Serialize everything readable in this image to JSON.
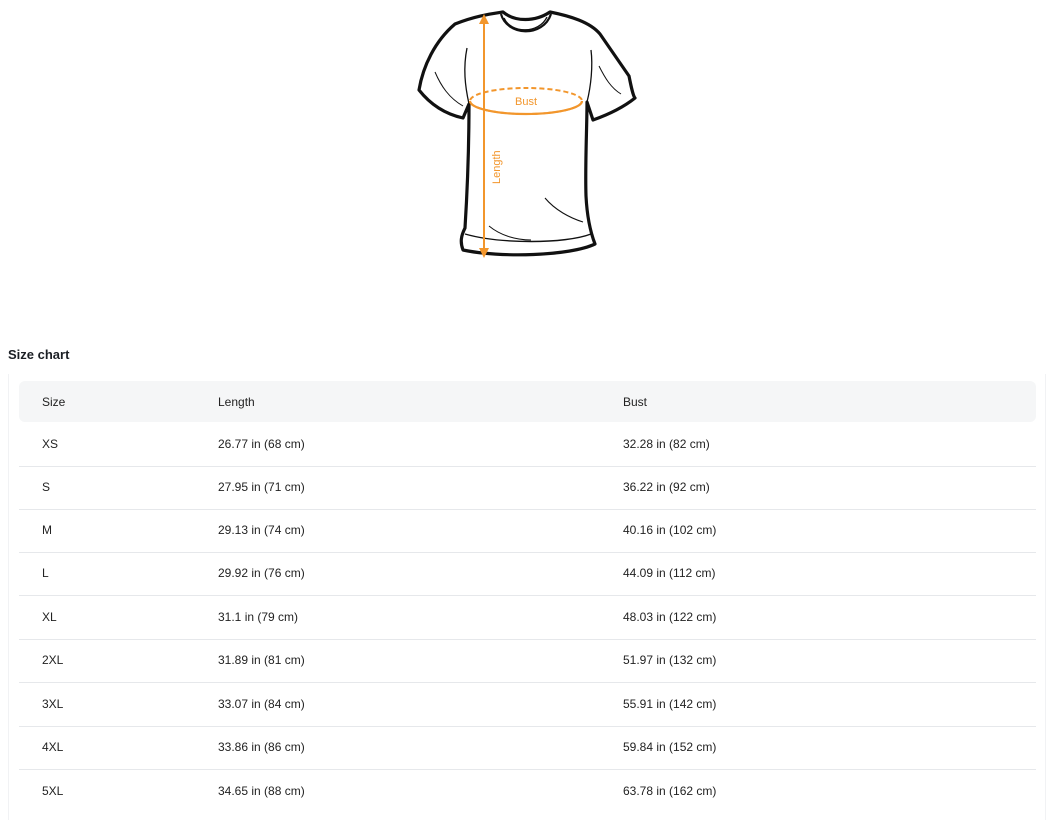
{
  "diagram": {
    "bust_label": "Bust",
    "length_label": "Length",
    "accent_color": "#f2962c"
  },
  "size_chart": {
    "title": "Size chart",
    "columns": [
      "Size",
      "Length",
      "Bust"
    ],
    "rows": [
      {
        "size": "XS",
        "length": "26.77 in  (68 cm)",
        "bust": "32.28 in  (82 cm)"
      },
      {
        "size": "S",
        "length": "27.95 in  (71 cm)",
        "bust": "36.22 in  (92 cm)"
      },
      {
        "size": "M",
        "length": "29.13 in  (74 cm)",
        "bust": "40.16 in  (102 cm)"
      },
      {
        "size": "L",
        "length": "29.92 in  (76 cm)",
        "bust": "44.09 in  (112 cm)"
      },
      {
        "size": "XL",
        "length": "31.1 in  (79 cm)",
        "bust": "48.03 in  (122 cm)"
      },
      {
        "size": "2XL",
        "length": "31.89 in  (81 cm)",
        "bust": "51.97 in  (132 cm)"
      },
      {
        "size": "3XL",
        "length": "33.07 in  (84 cm)",
        "bust": "55.91 in  (142 cm)"
      },
      {
        "size": "4XL",
        "length": "33.86 in  (86 cm)",
        "bust": "59.84 in  (152 cm)"
      },
      {
        "size": "5XL",
        "length": "34.65 in  (88 cm)",
        "bust": "63.78 in  (162 cm)"
      }
    ]
  }
}
